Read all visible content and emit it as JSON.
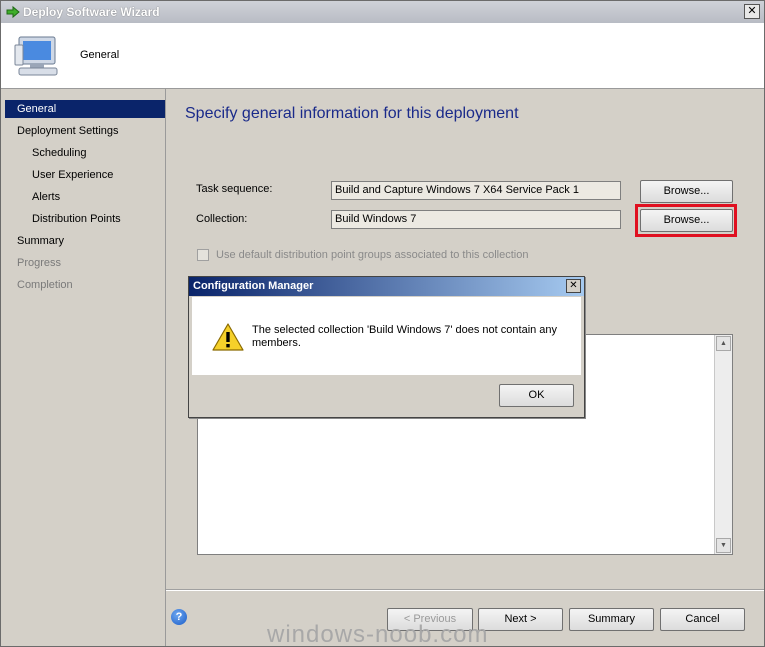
{
  "window": {
    "title": "Deploy Software Wizard",
    "close_glyph": "✕"
  },
  "header": {
    "title": "General"
  },
  "sidebar": {
    "items": [
      {
        "label": "General"
      },
      {
        "label": "Deployment Settings"
      },
      {
        "label": "Scheduling"
      },
      {
        "label": "User Experience"
      },
      {
        "label": "Alerts"
      },
      {
        "label": "Distribution Points"
      },
      {
        "label": "Summary"
      },
      {
        "label": "Progress"
      },
      {
        "label": "Completion"
      }
    ]
  },
  "main": {
    "page_title": "Specify general information for this deployment",
    "task_sequence_label": "Task sequence:",
    "task_sequence_value": "Build and Capture Windows 7 X64 Service Pack 1",
    "collection_label": "Collection:",
    "collection_value": "Build Windows 7",
    "browse_label": "Browse...",
    "checkbox_label": "Use default distribution point groups associated to this collection"
  },
  "footer": {
    "previous_label": "< Previous",
    "next_label": "Next >",
    "summary_label": "Summary",
    "cancel_label": "Cancel",
    "help_glyph": "?"
  },
  "dialog": {
    "title": "Configuration Manager",
    "message": "The selected collection 'Build Windows 7' does not contain any members.",
    "ok_label": "OK",
    "close_glyph": "✕"
  },
  "watermark": "windows-noob.com",
  "colors": {
    "accent": "#0a246a",
    "highlight": "#e01020",
    "title_blue": "#1a2a8a"
  }
}
